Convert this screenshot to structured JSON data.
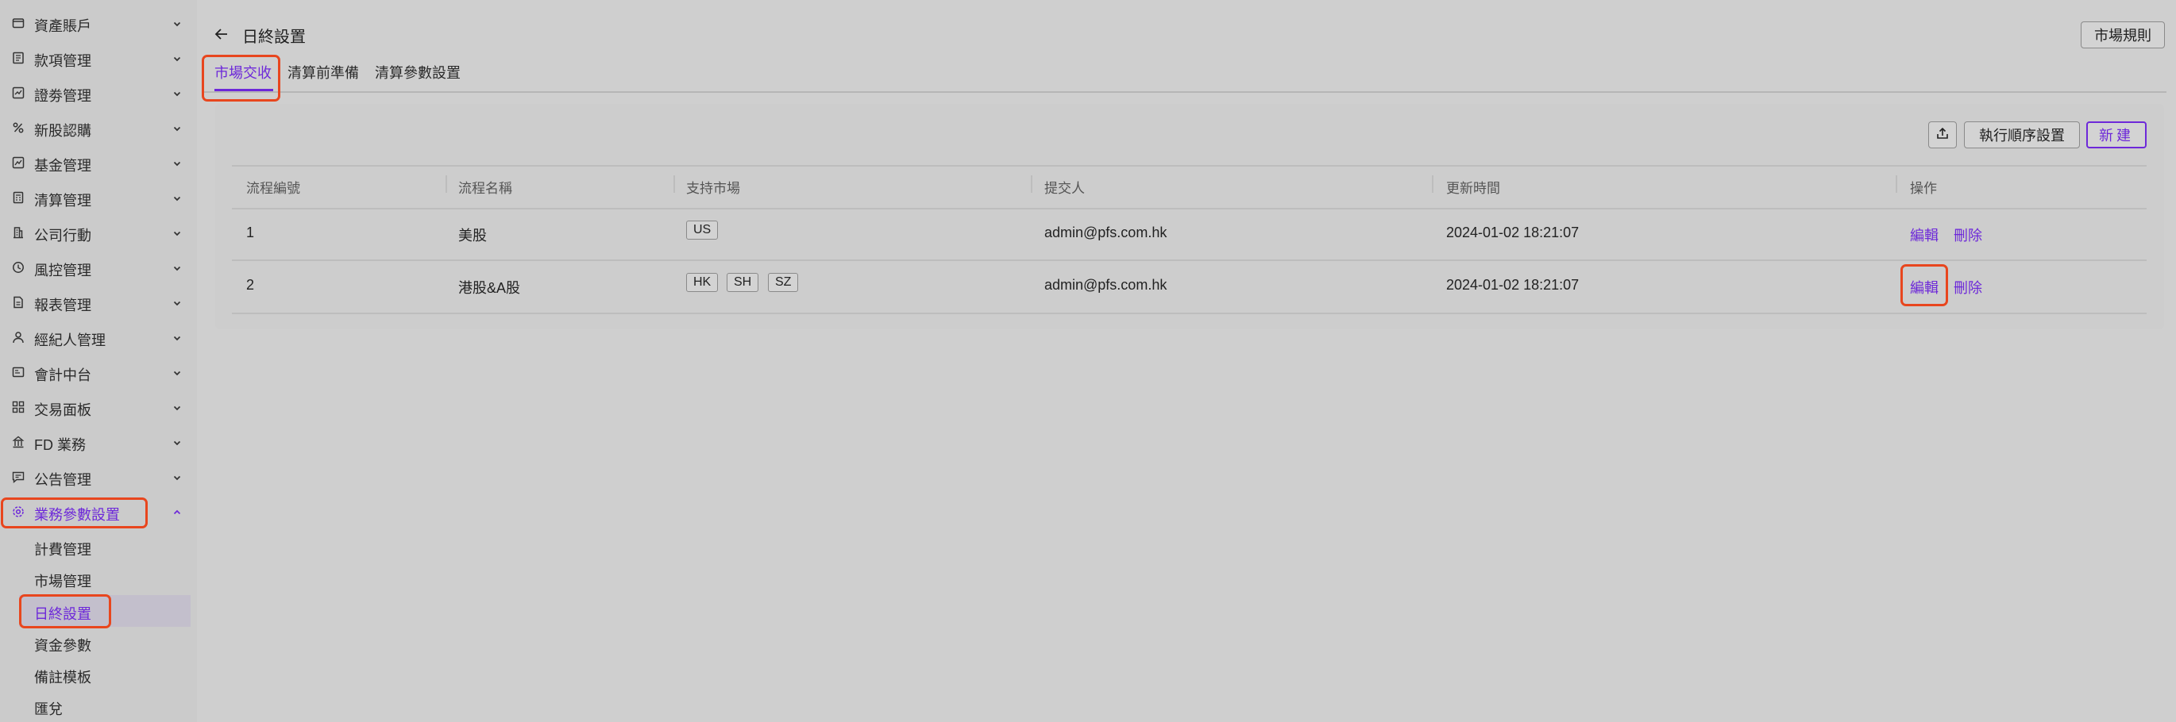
{
  "sidebar": {
    "items": [
      {
        "label": "資產賬戶",
        "icon": "wallet-icon"
      },
      {
        "label": "款項管理",
        "icon": "document-icon"
      },
      {
        "label": "證劵管理",
        "icon": "chart-icon"
      },
      {
        "label": "新股認購",
        "icon": "percent-icon"
      },
      {
        "label": "基金管理",
        "icon": "fund-icon"
      },
      {
        "label": "清算管理",
        "icon": "calculator-icon"
      },
      {
        "label": "公司行動",
        "icon": "building-icon"
      },
      {
        "label": "風控管理",
        "icon": "shield-icon"
      },
      {
        "label": "報表管理",
        "icon": "report-icon"
      },
      {
        "label": "經紀人管理",
        "icon": "user-icon"
      },
      {
        "label": "會計中台",
        "icon": "ledger-icon"
      },
      {
        "label": "交易面板",
        "icon": "grid-icon"
      },
      {
        "label": "FD 業務",
        "icon": "bank-icon"
      },
      {
        "label": "公告管理",
        "icon": "message-icon"
      },
      {
        "label": "業務參數設置",
        "icon": "settings-icon"
      }
    ],
    "sub_items": [
      "計費管理",
      "市場管理",
      "日終設置",
      "資金參數",
      "備註模板",
      "匯兌"
    ]
  },
  "header": {
    "title": "日終設置",
    "market_rules_button": "市場規則"
  },
  "tabs": [
    "市場交收",
    "清算前準備",
    "清算參數設置"
  ],
  "toolbar": {
    "order_button": "執行順序設置",
    "new_button": "新建"
  },
  "table": {
    "columns": [
      "流程編號",
      "流程名稱",
      "支持市場",
      "提交人",
      "更新時間",
      "操作"
    ],
    "rows": [
      {
        "id": "1",
        "name": "美股",
        "markets": [
          "US"
        ],
        "submitter": "admin@pfs.com.hk",
        "updated": "2024-01-02 18:21:07",
        "edit": "編輯",
        "delete": "刪除"
      },
      {
        "id": "2",
        "name": "港股&A股",
        "markets": [
          "HK",
          "SH",
          "SZ"
        ],
        "submitter": "admin@pfs.com.hk",
        "updated": "2024-01-02 18:21:07",
        "edit": "編輯",
        "delete": "刪除"
      }
    ]
  },
  "colors": {
    "accent": "#6d28d9",
    "highlight": "#e8461e",
    "background": "#cfcfcf"
  }
}
